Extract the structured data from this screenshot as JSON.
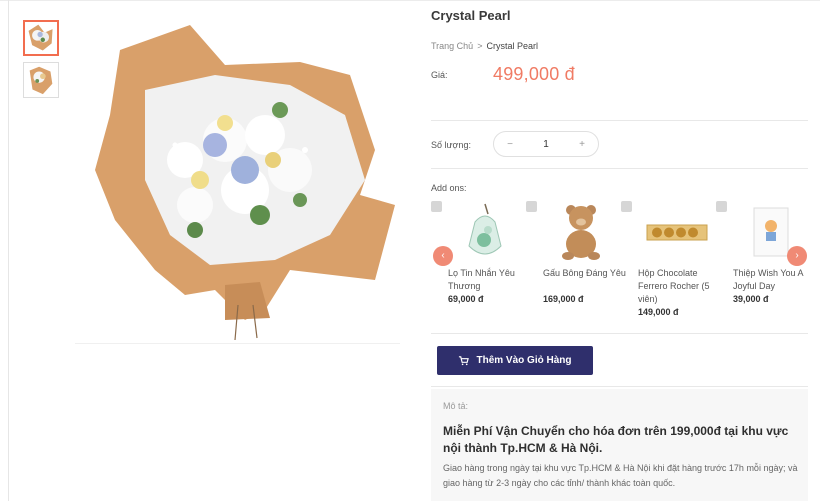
{
  "product": {
    "title": "Crystal Pearl",
    "breadcrumb": {
      "home": "Trang Chủ",
      "separator": ">",
      "current": "Crystal Pearl"
    },
    "price_label": "Giá:",
    "price": "499,000 đ"
  },
  "quantity": {
    "label": "Số lượng:",
    "minus": "−",
    "value": "1",
    "plus": "+"
  },
  "addons": {
    "label": "Add ons:",
    "items": [
      {
        "name": "Lọ Tin Nhắn Yêu Thương",
        "price": "69,000 đ",
        "icon": "glass-bottle-icon"
      },
      {
        "name": "Gấu Bông Đáng Yêu",
        "price": "169,000 đ",
        "icon": "teddy-bear-icon"
      },
      {
        "name": "Hộp Chocolate Ferrero Rocher (5 viên)",
        "price": "149,000 đ",
        "icon": "chocolate-box-icon"
      },
      {
        "name": "Thiệp Wish You A Joyful Day",
        "price": "39,000 đ",
        "icon": "greeting-card-icon"
      }
    ],
    "prev": "‹",
    "next": "›"
  },
  "cart_button": {
    "label": "Thêm Vào Giỏ Hàng",
    "icon": "cart-icon"
  },
  "description": {
    "label": "Mô tả:",
    "headline": "Miễn Phí Vận Chuyển cho hóa đơn trên 199,000đ tại khu vực nội thành Tp.HCM & Hà Nội.",
    "body": "Giao hàng trong ngày tại khu vực Tp.HCM & Hà Nội khi đặt hàng trước 17h mỗi ngày; và giao hàng từ 2-3 ngày cho các tỉnh/ thành khác toàn quốc."
  },
  "colors": {
    "accent": "#f07b64",
    "button": "#2f2f6c",
    "wrap": "#d9a06a"
  }
}
